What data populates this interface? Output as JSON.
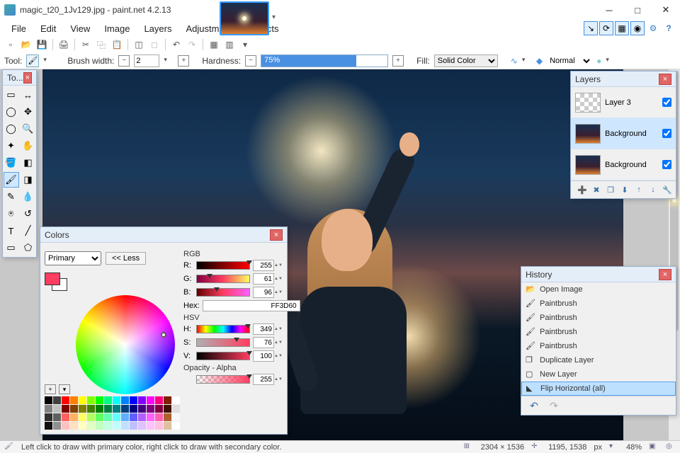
{
  "title": "magic_t20_1Jv129.jpg - paint.net 4.2.13",
  "menu": [
    "File",
    "Edit",
    "View",
    "Image",
    "Layers",
    "Adjustments",
    "Effects"
  ],
  "quick_icons": [
    "tools-icon",
    "history-icon",
    "layers-icon",
    "colors-icon",
    "settings-icon",
    "help-icon"
  ],
  "toolbar2": {
    "tool_lbl": "Tool:",
    "brushwidth_lbl": "Brush width:",
    "brushwidth_val": "2",
    "hardness_lbl": "Hardness:",
    "hardness_val": "75%",
    "hardness_pct": 75,
    "fill_lbl": "Fill:",
    "fill_val": "Solid Color",
    "blend_val": "Normal"
  },
  "tools_panel": {
    "title": "To..."
  },
  "layers_panel": {
    "title": "Layers",
    "rows": [
      {
        "name": "Layer 3",
        "checked": true,
        "checker": true
      },
      {
        "name": "Background",
        "checked": true,
        "sel": true
      },
      {
        "name": "Background",
        "checked": true
      }
    ]
  },
  "history_panel": {
    "title": "History",
    "rows": [
      {
        "icon": "📂",
        "label": "Open Image"
      },
      {
        "icon": "🖌",
        "label": "Paintbrush"
      },
      {
        "icon": "🖌",
        "label": "Paintbrush"
      },
      {
        "icon": "🖌",
        "label": "Paintbrush"
      },
      {
        "icon": "🖌",
        "label": "Paintbrush"
      },
      {
        "icon": "❐",
        "label": "Duplicate Layer"
      },
      {
        "icon": "▢",
        "label": "New Layer"
      },
      {
        "icon": "◣",
        "label": "Flip Horizontal (all)",
        "sel": true
      }
    ]
  },
  "colors_panel": {
    "title": "Colors",
    "mode": "Primary",
    "less": "<< Less",
    "primary_hex": "#FF3D60",
    "rgb_lbl": "RGB",
    "hsv_lbl": "HSV",
    "hex_lbl": "Hex:",
    "hex_val": "FF3D60",
    "opacity_lbl": "Opacity - Alpha",
    "r": {
      "lbl": "R:",
      "val": "255",
      "pos": 100
    },
    "g": {
      "lbl": "G:",
      "val": "61",
      "pos": 24
    },
    "b": {
      "lbl": "B:",
      "val": "96",
      "pos": 38
    },
    "h": {
      "lbl": "H:",
      "val": "349",
      "pos": 97
    },
    "s": {
      "lbl": "S:",
      "val": "76",
      "pos": 76
    },
    "v": {
      "lbl": "V:",
      "val": "100",
      "pos": 100
    },
    "a": {
      "val": "255",
      "pos": 100
    }
  },
  "status": {
    "hint": "Left click to draw with primary color, right click to draw with secondary color.",
    "dims": "2304 × 1536",
    "cursor": "1195, 1538",
    "unit": "px",
    "zoom": "48%"
  },
  "palette_colors": [
    "#000000",
    "#404040",
    "#ff0000",
    "#ff8000",
    "#ffff00",
    "#80ff00",
    "#00ff00",
    "#00ff80",
    "#00ffff",
    "#0080ff",
    "#0000ff",
    "#8000ff",
    "#ff00ff",
    "#ff0080",
    "#802000",
    "#ffffff",
    "#808080",
    "#c0c0c0",
    "#800000",
    "#804000",
    "#808000",
    "#408000",
    "#008000",
    "#008040",
    "#008080",
    "#004080",
    "#000080",
    "#400080",
    "#800080",
    "#800040",
    "#401000",
    "#e0e0e0",
    "#303030",
    "#606060",
    "#ff6060",
    "#ffb060",
    "#ffff60",
    "#b0ff60",
    "#60ff60",
    "#60ffb0",
    "#60ffff",
    "#60b0ff",
    "#6060ff",
    "#b060ff",
    "#ff60ff",
    "#ff60b0",
    "#b06030",
    "#f8f8f8",
    "#101010",
    "#909090",
    "#ffc0c0",
    "#ffe0c0",
    "#ffffc0",
    "#e0ffc0",
    "#c0ffc0",
    "#c0ffe0",
    "#c0ffff",
    "#c0e0ff",
    "#c0c0ff",
    "#e0c0ff",
    "#ffc0ff",
    "#ffc0e0",
    "#e0c0a0",
    "#ffffff"
  ]
}
